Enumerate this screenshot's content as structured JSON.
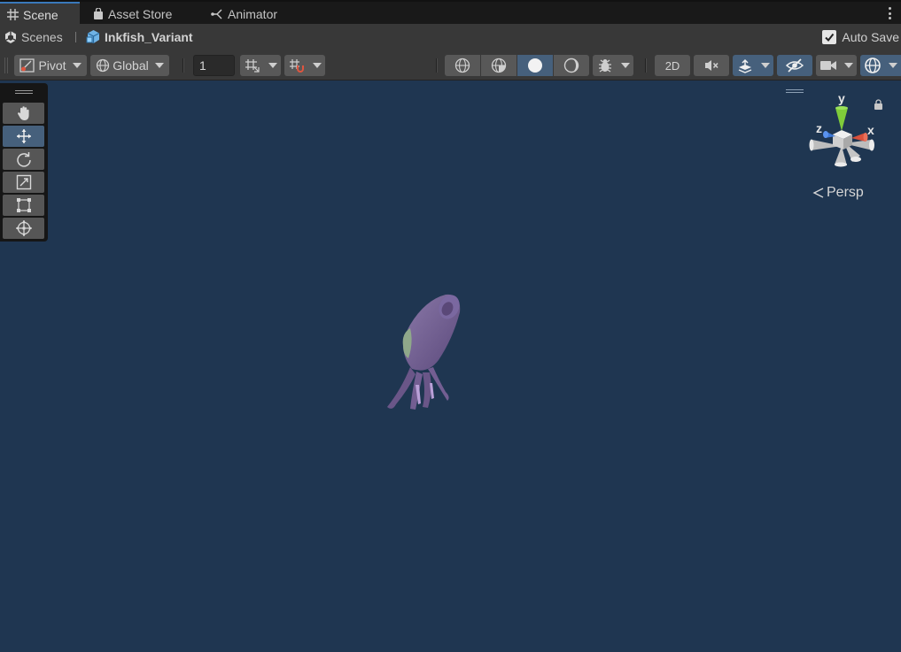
{
  "tabs": [
    {
      "label": "Scene",
      "icon": "grid-icon",
      "active": true
    },
    {
      "label": "Asset Store",
      "icon": "shopping-bag-icon",
      "active": false
    },
    {
      "label": "Animator",
      "icon": "animator-icon",
      "active": false
    }
  ],
  "breadcrumb": {
    "root": "Scenes",
    "current": "Inkfish_Variant"
  },
  "autosave": {
    "label": "Auto Save",
    "checked": true
  },
  "toolbar": {
    "pivot_label": "Pivot",
    "global_label": "Global",
    "grid_snap_value": "1",
    "mode_2d_label": "2D"
  },
  "tools": [
    {
      "name": "hand-tool",
      "icon": "hand-icon"
    },
    {
      "name": "move-tool",
      "icon": "move-icon",
      "active": true
    },
    {
      "name": "rotate-tool",
      "icon": "rotate-icon"
    },
    {
      "name": "scale-tool",
      "icon": "scale-icon"
    },
    {
      "name": "rect-tool",
      "icon": "rect-transform-icon"
    },
    {
      "name": "transform-tool",
      "icon": "transform-icon"
    }
  ],
  "gizmo": {
    "axis_y": "y",
    "axis_x": "x",
    "axis_z": "z",
    "projection_label": "Persp"
  },
  "colors": {
    "viewport_bg": "#1f3651",
    "accent_blue": "#46607c",
    "axis_x": "#d9503b",
    "axis_y": "#7fcc3a",
    "axis_z": "#3d78d8",
    "squid_body": "#6e5a8e"
  }
}
